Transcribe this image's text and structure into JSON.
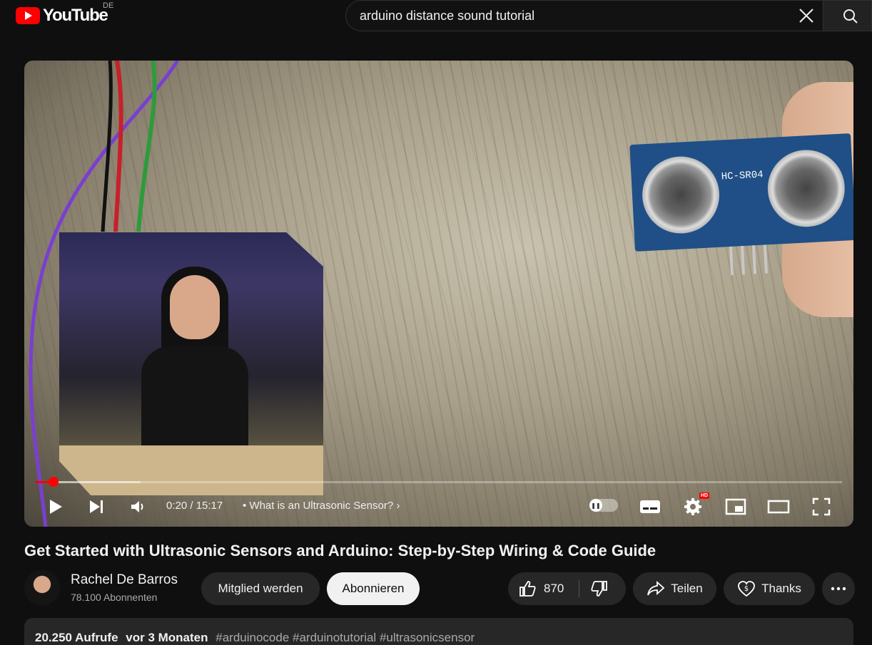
{
  "header": {
    "logo_text": "YouTube",
    "country": "DE",
    "search_value": "arduino distance sound tutorial"
  },
  "player": {
    "sensor_label": "HC-SR04",
    "progress": {
      "played_fraction": 0.022,
      "loaded_fraction": 0.13
    },
    "time": "0:20 / 15:17",
    "chapter": "What is an Ultrasonic Sensor?",
    "hd_badge": "HD",
    "icons": [
      "play-icon",
      "next-icon",
      "volume-icon",
      "autoplay-toggle",
      "subtitles-icon",
      "settings-icon",
      "miniplayer-icon",
      "theater-icon",
      "fullscreen-icon"
    ]
  },
  "video": {
    "title": "Get Started with Ultrasonic Sensors and Arduino: Step-by-Step Wiring & Code Guide"
  },
  "channel": {
    "name": "Rachel De Barros",
    "subscribers": "78.100 Abonnenten",
    "join_label": "Mitglied werden",
    "subscribe_label": "Abonnieren"
  },
  "actions": {
    "likes": "870",
    "share_label": "Teilen",
    "thanks_label": "Thanks"
  },
  "description": {
    "views": "20.250 Aufrufe",
    "date": "vor 3 Monaten",
    "tags": [
      "#arduinocode",
      "#arduinotutorial",
      "#ultrasonicsensor"
    ]
  },
  "colors": {
    "accent": "#ff0000",
    "background": "#0f0f0f",
    "pill": "#272727"
  }
}
